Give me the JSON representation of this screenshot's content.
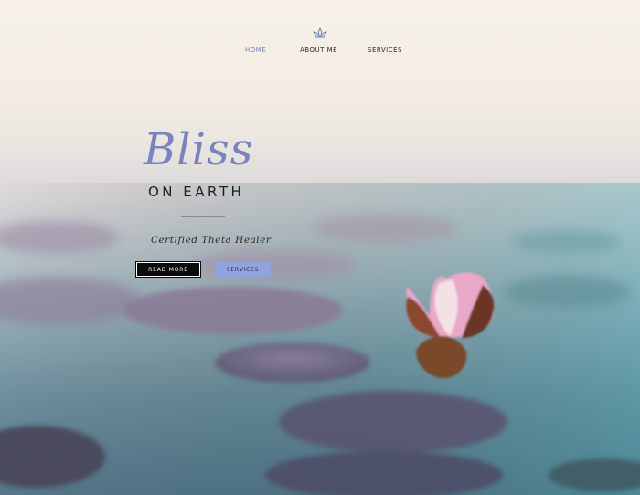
{
  "nav": {
    "logo_icon": "lotus-icon",
    "items": [
      {
        "label": "HOME",
        "active": true
      },
      {
        "label": "ABOUT ME",
        "active": false
      },
      {
        "label": "SERVICES",
        "active": false
      }
    ],
    "active_color": "#6f7ec8"
  },
  "hero": {
    "title_script": "Bliss",
    "title_sub": "ON EARTH",
    "tagline": "Certified Theta Healer",
    "buttons": {
      "read_more": "READ MORE",
      "services": "SERVICES"
    },
    "colors": {
      "accent": "#7a83be",
      "button_primary_bg": "#0b0b0b",
      "button_secondary_bg": "#8fa3dc"
    }
  }
}
